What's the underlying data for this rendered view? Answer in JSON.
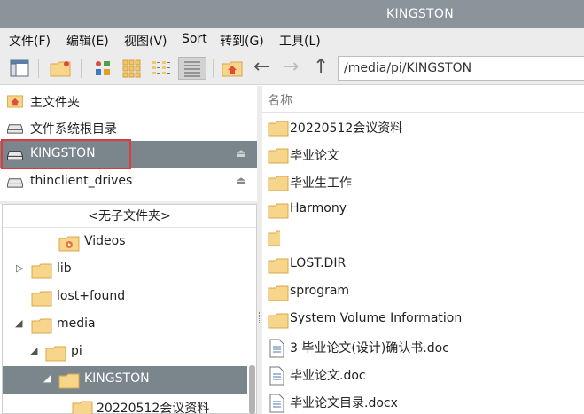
{
  "window": {
    "title": "KINGSTON"
  },
  "menu": [
    {
      "label": "文件(F)"
    },
    {
      "label": "编辑(E)"
    },
    {
      "label": "视图(V)"
    },
    {
      "label": "Sort"
    },
    {
      "label": "转到(G)"
    },
    {
      "label": "工具(L)"
    }
  ],
  "toolbar": {
    "icons": [
      "new-window-icon",
      "new-folder-icon",
      "icon-view-icon",
      "thumbnail-view-icon",
      "compact-view-icon",
      "detailed-list-view-icon",
      "home-icon",
      "back-arrow-icon",
      "forward-arrow-icon",
      "up-arrow-icon"
    ],
    "path": "/media/pi/KINGSTON"
  },
  "places": [
    {
      "label": "主文件夹",
      "icon": "home-icon"
    },
    {
      "label": "文件系统根目录",
      "icon": "drive-icon"
    },
    {
      "label": "KINGSTON",
      "icon": "drive-icon",
      "selected": true,
      "eject": "⏏"
    },
    {
      "label": "thinclient_drives",
      "icon": "drive-icon",
      "eject": "⏏"
    }
  ],
  "tree": {
    "header": "<无子文件夹>",
    "nodes": [
      {
        "label": "Videos",
        "icon": "video-folder-icon"
      },
      {
        "label": "lib",
        "expander": "▷"
      },
      {
        "label": "lost+found"
      },
      {
        "label": "media",
        "expander": "◢"
      },
      {
        "label": "pi",
        "expander": "◢"
      },
      {
        "label": "KINGSTON",
        "expander": "◢",
        "selected": true
      },
      {
        "label": "20220512会议资料"
      }
    ]
  },
  "files": {
    "column_header": "名称",
    "items": [
      {
        "name": "20220512会议资料",
        "type": "folder"
      },
      {
        "name": "毕业论文",
        "type": "folder"
      },
      {
        "name": "毕业生工作",
        "type": "folder"
      },
      {
        "name": "Harmony",
        "type": "folder"
      },
      {
        "name": "",
        "type": "folder"
      },
      {
        "name": "LOST.DIR",
        "type": "folder"
      },
      {
        "name": "sprogram",
        "type": "folder"
      },
      {
        "name": "System Volume Information",
        "type": "folder"
      },
      {
        "name": "3 毕业论文(设计)确认书.doc",
        "type": "doc"
      },
      {
        "name": "毕业论文.doc",
        "type": "doc"
      },
      {
        "name": "毕业论文目录.docx",
        "type": "doc"
      }
    ]
  },
  "colors": {
    "titlebar": "#8a949a",
    "selection": "#7a858c",
    "folder": "#f7d58a",
    "highlight_box": "#e0393d"
  }
}
